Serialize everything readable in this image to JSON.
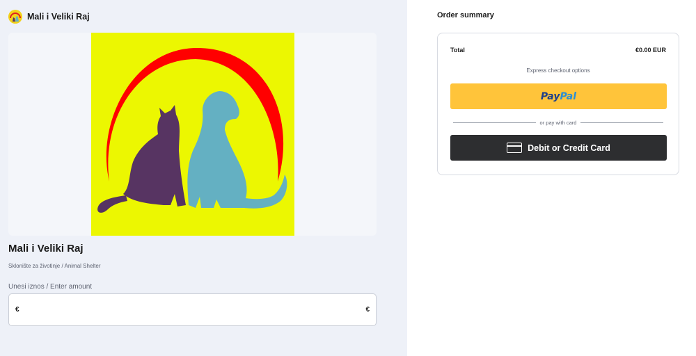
{
  "brand": {
    "name": "Mali i Veliki Raj",
    "logo_icon": "shelter-logo-icon"
  },
  "hero": {
    "image": "cat-and-dog-silhouette-logo",
    "colors": {
      "background": "#ecf701",
      "arc": "#ff0000",
      "cat": "#573462",
      "dog": "#64b0c2"
    }
  },
  "organization": {
    "title": "Mali i Veliki Raj",
    "subtitle": "Sklonište za životinje / Animal Shelter"
  },
  "amount": {
    "label": "Unesi iznos / Enter amount",
    "currency_prefix": "€",
    "currency_suffix": "€",
    "value": "",
    "placeholder": ""
  },
  "summary": {
    "title": "Order summary",
    "total_label": "Total",
    "total_value": "€0.00 EUR",
    "express_label": "Express checkout options",
    "paypal": {
      "part1": "Pay",
      "part2": "Pal",
      "color": "#ffc43a"
    },
    "divider_label": "or pay with card",
    "card_button_label": "Debit or Credit Card",
    "card_button_icon": "credit-card-icon"
  }
}
